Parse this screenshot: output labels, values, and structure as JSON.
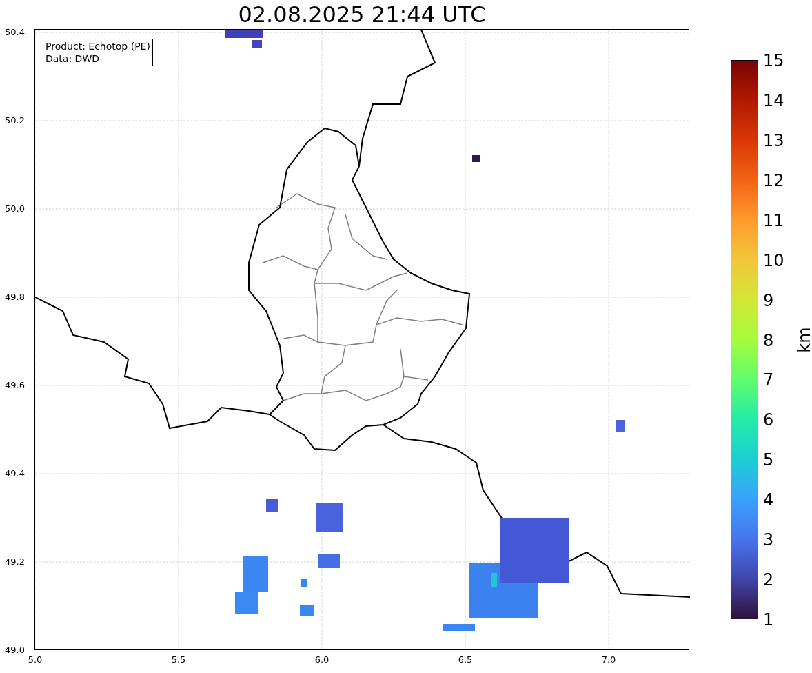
{
  "title": "02.08.2025 21:44 UTC",
  "legend": [
    "Product: Echotop (PE)",
    "Data: DWD"
  ],
  "x_ticks": [
    "5.0",
    "5.5",
    "6.0",
    "6.5",
    "7.0"
  ],
  "y_ticks": [
    "50.4",
    "50.2",
    "50.0",
    "49.8",
    "49.6",
    "49.4",
    "49.2",
    "49.0"
  ],
  "colorbar": {
    "label": "km",
    "ticks": [
      "15",
      "14",
      "13",
      "12",
      "11",
      "10",
      "9",
      "8",
      "7",
      "6",
      "5",
      "4",
      "3",
      "2",
      "1"
    ]
  }
}
